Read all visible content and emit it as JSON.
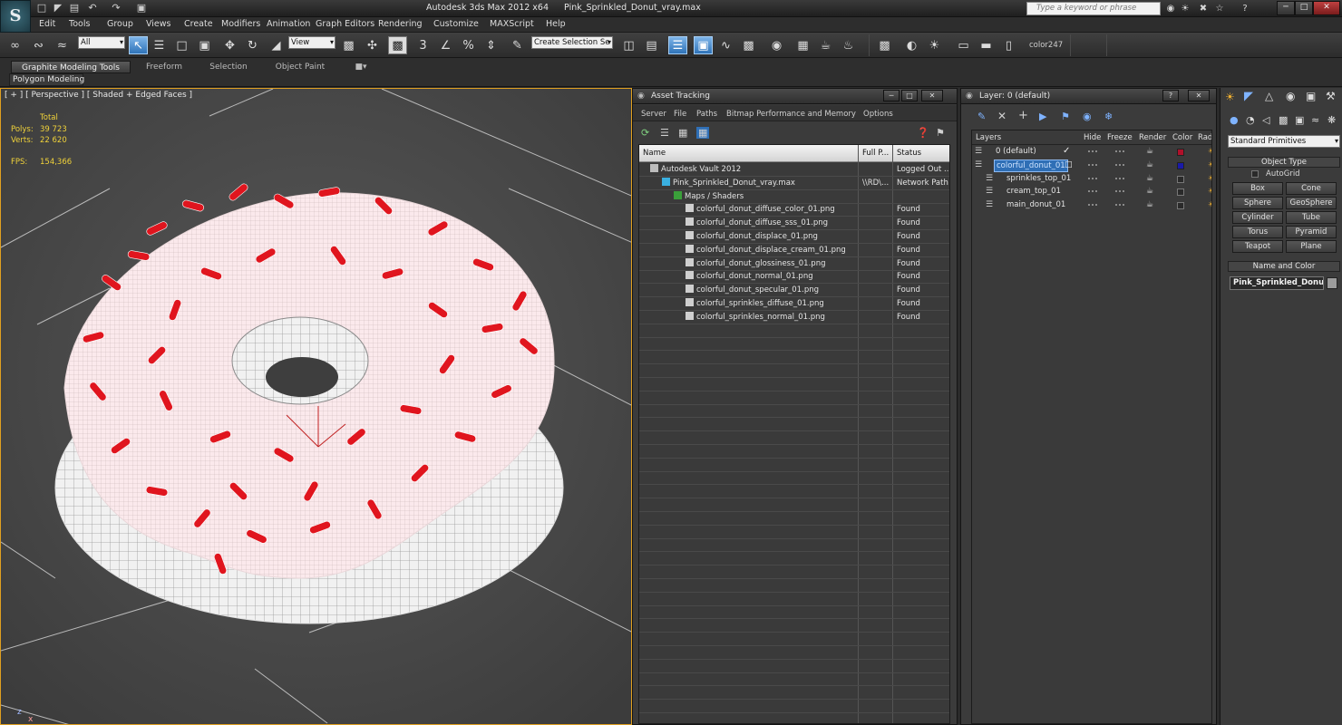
{
  "app": {
    "logo": "S",
    "product": "Autodesk 3ds Max  2012 x64",
    "file": "Pink_Sprinkled_Donut_vray.max",
    "search_placeholder": "Type a keyword or phrase"
  },
  "menubar": [
    "Edit",
    "Tools",
    "Group",
    "Views",
    "Create",
    "Modifiers",
    "Animation",
    "Graph Editors",
    "Rendering",
    "Customize",
    "MAXScript",
    "Help"
  ],
  "toolbar": {
    "selection_filter": "All",
    "ref_coord": "View",
    "named_selection": "Create Selection Se",
    "color_label": "color247"
  },
  "ribbon": {
    "tabs": [
      "Graphite Modeling Tools",
      "Freeform",
      "Selection",
      "Object Paint"
    ],
    "panel": "Polygon Modeling"
  },
  "viewport": {
    "label": "[ + ] [ Perspective ] [ Shaded + Edged Faces ]",
    "stats": {
      "total_label": "Total",
      "polys_label": "Polys:",
      "polys": "39 723",
      "verts_label": "Verts:",
      "verts": "22 620",
      "fps_label": "FPS:",
      "fps": "154,366"
    }
  },
  "asset_tracking": {
    "title": "Asset Tracking",
    "menu": [
      "Server",
      "File",
      "Paths",
      "Bitmap Performance and Memory",
      "Options"
    ],
    "columns": [
      "Name",
      "Full P...",
      "Status"
    ],
    "rows": [
      {
        "name": "Autodesk Vault 2012",
        "path": "",
        "status": "Logged Out ...",
        "indent": 0
      },
      {
        "name": "Pink_Sprinkled_Donut_vray.max",
        "path": "\\\\RD\\...",
        "status": "Network Path",
        "indent": 1
      },
      {
        "name": "Maps / Shaders",
        "path": "",
        "status": "",
        "indent": 2
      },
      {
        "name": "colorful_donut_diffuse_color_01.png",
        "path": "",
        "status": "Found",
        "indent": 3
      },
      {
        "name": "colorful_donut_diffuse_sss_01.png",
        "path": "",
        "status": "Found",
        "indent": 3
      },
      {
        "name": "colorful_donut_displace_01.png",
        "path": "",
        "status": "Found",
        "indent": 3
      },
      {
        "name": "colorful_donut_displace_cream_01.png",
        "path": "",
        "status": "Found",
        "indent": 3
      },
      {
        "name": "colorful_donut_glossiness_01.png",
        "path": "",
        "status": "Found",
        "indent": 3
      },
      {
        "name": "colorful_donut_normal_01.png",
        "path": "",
        "status": "Found",
        "indent": 3
      },
      {
        "name": "colorful_donut_specular_01.png",
        "path": "",
        "status": "Found",
        "indent": 3
      },
      {
        "name": "colorful_sprinkles_diffuse_01.png",
        "path": "",
        "status": "Found",
        "indent": 3
      },
      {
        "name": "colorful_sprinkles_normal_01.png",
        "path": "",
        "status": "Found",
        "indent": 3
      }
    ]
  },
  "layers": {
    "title": "Layer: 0 (default)",
    "columns": [
      "Layers",
      "Hide",
      "Freeze",
      "Render",
      "Color",
      "Rad"
    ],
    "rows": [
      {
        "name": "0 (default)",
        "color": "#b0102a",
        "selected": false,
        "indent": 0
      },
      {
        "name": "colorful_donut_01",
        "color": "#1a1aa8",
        "selected": true,
        "indent": 0
      },
      {
        "name": "sprinkles_top_01",
        "color": "",
        "selected": false,
        "indent": 1
      },
      {
        "name": "cream_top_01",
        "color": "",
        "selected": false,
        "indent": 1
      },
      {
        "name": "main_donut_01",
        "color": "",
        "selected": false,
        "indent": 1
      }
    ]
  },
  "command_panel": {
    "category": "Standard Primitives",
    "object_type_title": "Object Type",
    "autogrid": "AutoGrid",
    "buttons": [
      "Box",
      "Cone",
      "Sphere",
      "GeoSphere",
      "Cylinder",
      "Tube",
      "Torus",
      "Pyramid",
      "Teapot",
      "Plane"
    ],
    "name_color_title": "Name and Color",
    "object_name": "Pink_Sprinkled_Donut"
  }
}
